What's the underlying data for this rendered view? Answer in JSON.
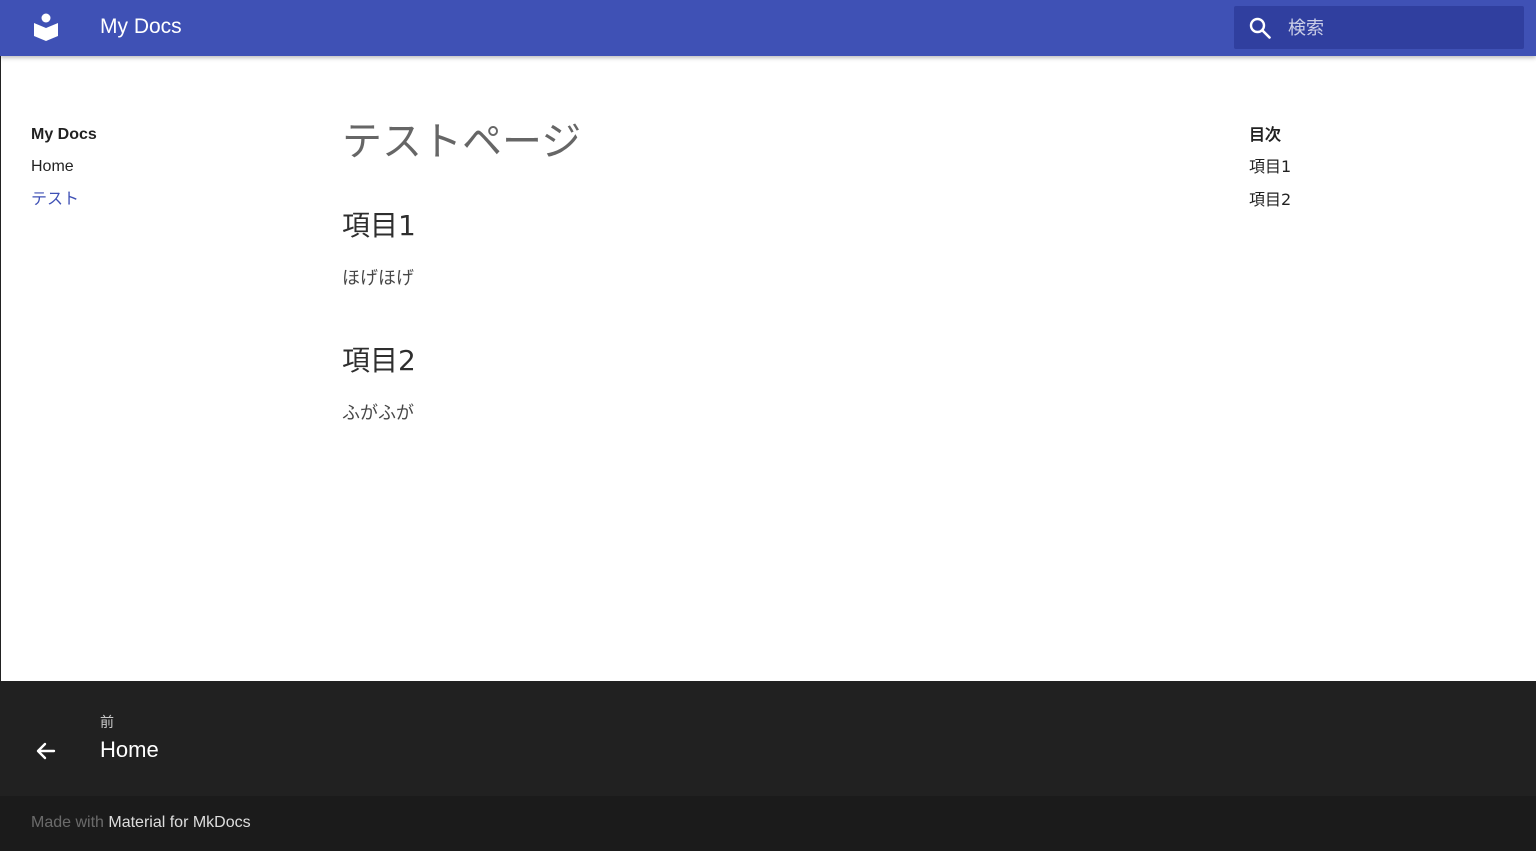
{
  "header": {
    "site_title": "My Docs",
    "search_placeholder": "検索",
    "logo_icon": "book-reader-icon",
    "search_icon": "search-icon",
    "background_color": "#3f51b5",
    "search_background_color": "#303f9f"
  },
  "sidebar": {
    "title": "My Docs",
    "items": [
      {
        "label": "Home",
        "active": false
      },
      {
        "label": "テスト",
        "active": true
      }
    ],
    "active_color": "#3f51b5"
  },
  "main": {
    "page_title": "テストページ",
    "sections": [
      {
        "heading": "項目1",
        "text": "ほげほげ"
      },
      {
        "heading": "項目2",
        "text": "ふがふが"
      }
    ]
  },
  "toc": {
    "title": "目次",
    "items": [
      "項目1",
      "項目2"
    ]
  },
  "footer": {
    "prev_direction": "前",
    "prev_title": "Home",
    "prev_icon": "arrow-left-icon",
    "made_with_prefix": "Made with",
    "made_with_link": "Material for MkDocs",
    "nav_background_color": "#212121",
    "meta_background_color": "#1b1b1b"
  }
}
